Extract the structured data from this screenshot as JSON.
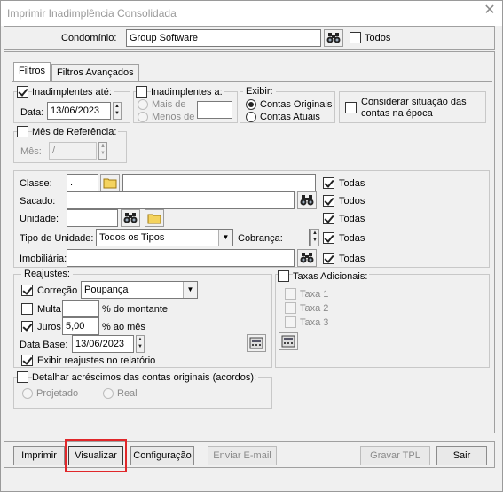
{
  "window": {
    "title": "Imprimir Inadimplência Consolidada"
  },
  "header": {
    "condominio_label": "Condomínio:",
    "condominio_value": "Group Software",
    "todos_label": "Todos",
    "todos_checked": false
  },
  "tabs": [
    {
      "label": "Filtros",
      "active": true
    },
    {
      "label": "Filtros Avançados",
      "active": false
    }
  ],
  "inadimplentes_ate": {
    "label": "Inadimplentes até:",
    "checked": true,
    "data_label": "Data:",
    "data_value": "13/06/2023"
  },
  "inadimplentes_a": {
    "label": "Inadimplentes a:",
    "checked": false,
    "mais_de": "Mais de",
    "menos_de": "Menos de"
  },
  "exibir": {
    "label": "Exibir:",
    "opt1": "Contas Originais",
    "opt2": "Contas Atuais",
    "selected": "Contas Originais"
  },
  "considerar": {
    "label": "Considerar situação das contas na época",
    "checked": false
  },
  "mes_referencia": {
    "label": "Mês de Referência:",
    "checked": false,
    "mes_label": "Mês:",
    "mes_value": "  /"
  },
  "filters": {
    "classe_label": "Classe:",
    "classe_value": ".",
    "sacado_label": "Sacado:",
    "unidade_label": "Unidade:",
    "tipo_unidade_label": "Tipo de Unidade:",
    "tipo_unidade_value": "Todos os Tipos",
    "cobranca_label": "Cobrança:",
    "imobiliaria_label": "Imobiliária:",
    "todas_label": "Todas",
    "todos_label": "Todos"
  },
  "reajustes": {
    "title": "Reajustes:",
    "correcao_label": "Correção",
    "correcao_checked": true,
    "correcao_value": "Poupança",
    "multa_label": "Multa",
    "multa_checked": false,
    "multa_suffix": "% do montante",
    "juros_label": "Juros",
    "juros_checked": true,
    "juros_value": "5,00",
    "juros_suffix": "% ao mês",
    "data_base_label": "Data Base:",
    "data_base_value": "13/06/2023",
    "exibir_label": "Exibir reajustes no relatório",
    "exibir_checked": true
  },
  "taxas": {
    "title": "Taxas Adicionais:",
    "checked": false,
    "taxa1": "Taxa 1",
    "taxa2": "Taxa 2",
    "taxa3": "Taxa 3"
  },
  "acordos": {
    "title": "Detalhar acréscimos das contas originais (acordos):",
    "checked": false,
    "projetado": "Projetado",
    "real": "Real"
  },
  "buttons": {
    "imprimir": "Imprimir",
    "visualizar": "Visualizar",
    "configuracao": "Configuração",
    "enviar_email": "Enviar E-mail",
    "gravar_tpl": "Gravar TPL",
    "sair": "Sair"
  },
  "colors": {
    "highlight": "#e0272a",
    "window_bg": "#f0f0f0"
  }
}
